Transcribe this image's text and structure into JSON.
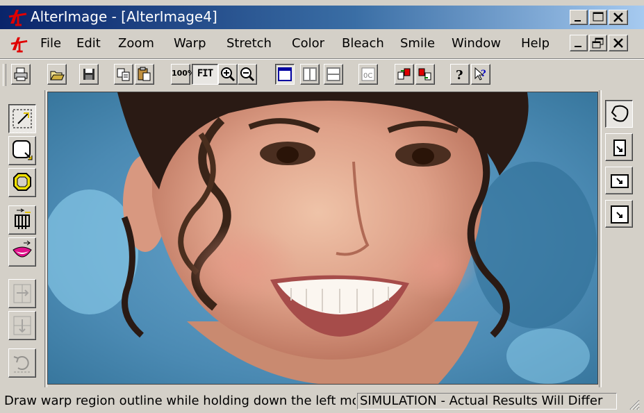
{
  "window": {
    "title": "AlterImage - [AlterImage4]",
    "logo_icon": "alterimage-logo-icon",
    "caption_buttons": [
      "minimize",
      "maximize",
      "close"
    ]
  },
  "menu": {
    "items": [
      "File",
      "Edit",
      "Zoom",
      "Warp",
      "Stretch",
      "Color",
      "Bleach",
      "Smile",
      "Window",
      "Help"
    ],
    "mdi_buttons": [
      "minimize",
      "restore",
      "close"
    ]
  },
  "toolbar": {
    "zoom_100_label": "100%",
    "fit_label": "FIT",
    "buttons": [
      "print-icon",
      "open-icon",
      "save-icon",
      "copy-icon",
      "paste-icon",
      "zoom-100-icon",
      "fit-icon",
      "zoom-in-icon",
      "zoom-out-icon",
      "single-view-icon",
      "split-vertical-icon",
      "split-horizontal-icon",
      "compare-icon",
      "before-after-icon",
      "swap-icon",
      "help-icon",
      "context-help-icon"
    ]
  },
  "left_tools": [
    "warp-region-tool-icon",
    "shrink-region-tool-icon",
    "round-region-tool-icon",
    "stretch-height-tool-icon",
    "smile-tool-icon",
    "flip-horizontal-icon",
    "flip-vertical-icon",
    "undo-icon"
  ],
  "right_tools": [
    "lasso-tool-icon",
    "arrow-size-small-icon",
    "arrow-size-medium-icon",
    "arrow-size-large-icon"
  ],
  "status": {
    "message": "Draw warp region outline while holding down the left mouse button",
    "notice": "SIMULATION - Actual Results Will Differ"
  },
  "colors": {
    "title_start": "#0a246a",
    "title_end": "#a6caf0",
    "face": "#d4d0c8"
  }
}
